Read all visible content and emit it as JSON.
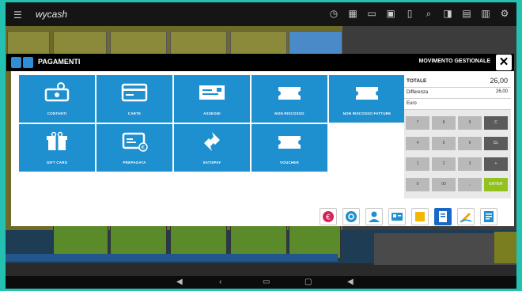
{
  "app": {
    "brand": "wycash"
  },
  "modal": {
    "title": "PAGAMENTI",
    "right_title": "MOVIMENTO GESTIONALE",
    "close_label": "✕"
  },
  "payment_methods": [
    {
      "label": "CONTANTI",
      "icon": "cash-icon"
    },
    {
      "label": "CARTE",
      "icon": "card-icon"
    },
    {
      "label": "ASSEGNI",
      "icon": "cheque-icon"
    },
    {
      "label": "NON RISCOSSO",
      "icon": "ticket-icon"
    },
    {
      "label": "NON RISCOSSO FATTURE",
      "icon": "ticket-icon"
    },
    {
      "label": "GIFT CARD",
      "icon": "gift-icon"
    },
    {
      "label": "PREPAGATA",
      "icon": "prepaid-card-icon"
    },
    {
      "label": "SATISPAY",
      "icon": "satispay-icon"
    },
    {
      "label": "VOUCHER",
      "icon": "ticket-icon"
    }
  ],
  "totals": {
    "total_label": "TOTALE",
    "total_value": "26,00",
    "diff_label": "Differenza",
    "diff_value": "26,00",
    "currency_label": "Euro"
  },
  "keypad": [
    [
      "7",
      "8",
      "9",
      "C"
    ],
    [
      "4",
      "5",
      "6",
      "CL"
    ],
    [
      "1",
      "2",
      "3",
      "+"
    ],
    [
      "0",
      "00",
      ",",
      "ENTER"
    ]
  ],
  "colors": {
    "tile_blue": "#1e8fcf",
    "accent_green": "#93c21f",
    "modal_header": "#000000",
    "outer_frame": "#25c1b0"
  }
}
